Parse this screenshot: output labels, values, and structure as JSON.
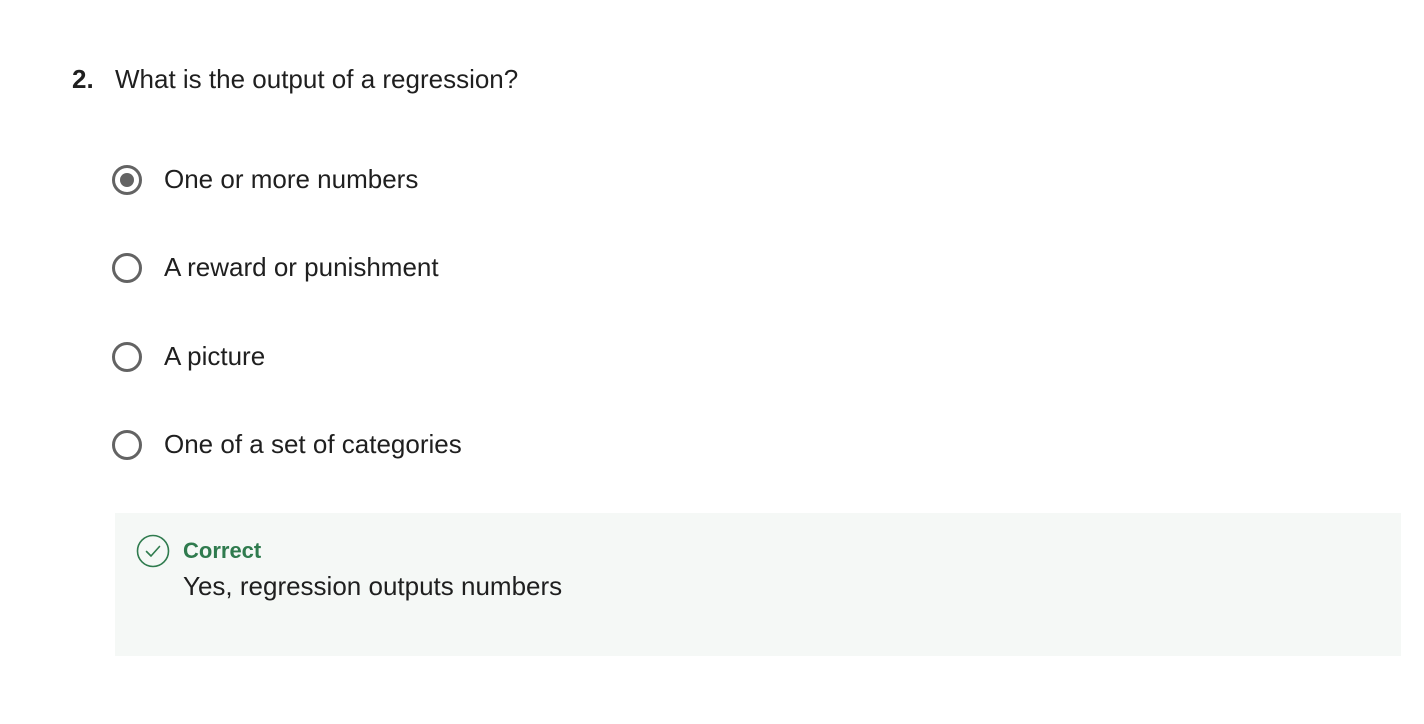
{
  "question": {
    "number": "2.",
    "text": "What is the output of a regression?"
  },
  "options": [
    {
      "label": "One or more numbers",
      "selected": true
    },
    {
      "label": "A reward or punishment",
      "selected": false
    },
    {
      "label": "A picture",
      "selected": false
    },
    {
      "label": "One of a set of categories",
      "selected": false
    }
  ],
  "feedback": {
    "status": "Correct",
    "message": "Yes, regression outputs numbers",
    "icon": "check-circle-icon",
    "status_color": "#2f7b4e",
    "background_color": "#f5f8f6"
  },
  "colors": {
    "radio_border": "#636363",
    "text": "#1f1f1f"
  }
}
